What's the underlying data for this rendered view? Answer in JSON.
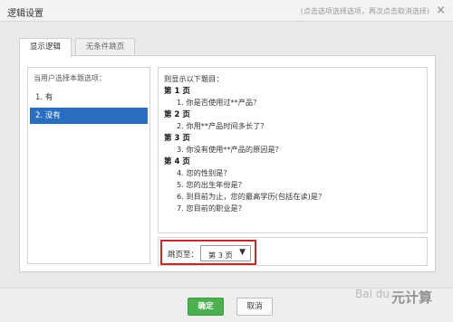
{
  "dialog": {
    "title": "逻辑设置",
    "hint": "(点击选项选择选项，再次点击取消选择)",
    "close_icon": "×"
  },
  "tabs": [
    {
      "label": "显示逻辑"
    },
    {
      "label": "无条件跳页"
    }
  ],
  "left": {
    "label": "当用户选择本题选项：",
    "options": [
      "1. 有",
      "2. 没有"
    ]
  },
  "right": {
    "lines": [
      "则显示以下题目：",
      "第 1 页",
      "1. 你是否使用过**产品？",
      "第 2 页",
      "2. 你用**产品时间多长了？",
      "第 3 页",
      "3. 你没有使用**产品的原因是？",
      "第 4 页",
      "4. 您的性别是？",
      "5. 您的出生年份是？",
      "6. 到目前为止，您的最高学历(包括在读)是？",
      "7. 您目前的职业是？"
    ]
  },
  "jump": {
    "label": "跳页至：",
    "selected": "第 3 页",
    "arrow": "▼"
  },
  "footer": {
    "ok_label": "确定",
    "cancel_label": "取消"
  },
  "watermark": {
    "brand": "Bai du",
    "text": "元计算"
  }
}
